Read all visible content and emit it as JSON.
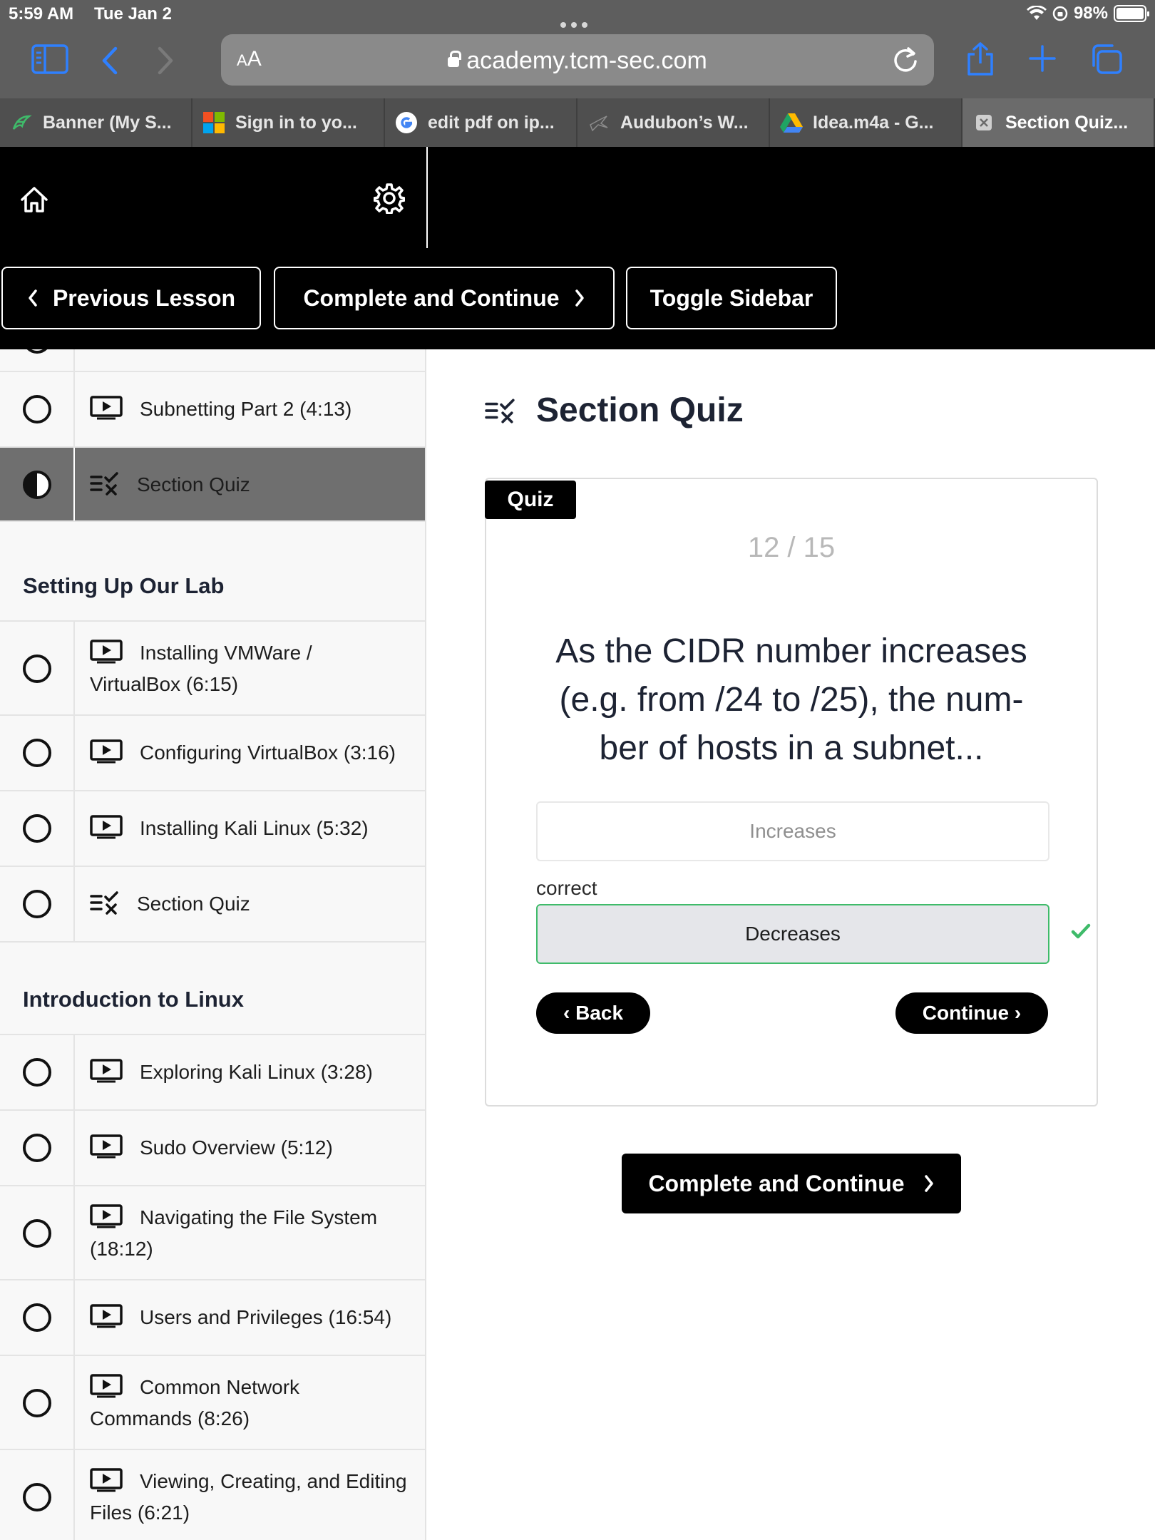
{
  "status_bar": {
    "time": "5:59 AM",
    "date": "Tue Jan 2",
    "battery": "98%"
  },
  "browser": {
    "text_size_label_small": "A",
    "text_size_label_large": "A",
    "url": "academy.tcm-sec.com",
    "tabs": [
      {
        "label": "Banner (My S...",
        "icon": "banner-favicon-icon"
      },
      {
        "label": "Sign in to yo...",
        "icon": "microsoft-favicon-icon"
      },
      {
        "label": "edit pdf on ip...",
        "icon": "google-favicon-icon"
      },
      {
        "label": "Audubon’s W...",
        "icon": "audubon-favicon-icon"
      },
      {
        "label": "Idea.m4a - G...",
        "icon": "google-drive-favicon-icon"
      },
      {
        "label": "Section Quiz...",
        "icon": "close-tab-icon"
      }
    ]
  },
  "course_header": {
    "previous_label": "Previous Lesson",
    "complete_label": "Complete and Continue",
    "toggle_label": "Toggle Sidebar"
  },
  "sidebar": {
    "lessons_top": [
      {
        "label": "Subnetting Part 2 (4:13)",
        "type": "video"
      },
      {
        "label": "Section Quiz",
        "type": "quiz",
        "active": true
      }
    ],
    "sections": [
      {
        "title": "Setting Up Our Lab",
        "lessons": [
          {
            "label_line1": "Installing VMWare /",
            "label_line2": "VirtualBox (6:15)",
            "type": "video"
          },
          {
            "label": "Configuring VirtualBox (3:16)",
            "type": "video"
          },
          {
            "label": "Installing Kali Linux (5:32)",
            "type": "video"
          },
          {
            "label": "Section Quiz",
            "type": "quiz"
          }
        ]
      },
      {
        "title": "Introduction to Linux",
        "lessons": [
          {
            "label": "Exploring Kali Linux (3:28)",
            "type": "video"
          },
          {
            "label": "Sudo Overview (5:12)",
            "type": "video"
          },
          {
            "label_line1": "Navigating the File System",
            "label_line2": "(18:12)",
            "type": "video"
          },
          {
            "label": "Users and Privileges (16:54)",
            "type": "video"
          },
          {
            "label_line1": "Common Network",
            "label_line2": "Commands (8:26)",
            "type": "video"
          },
          {
            "label_line1": "Viewing, Creating, and Editing",
            "label_line2": "Files (6:21)",
            "type": "video"
          }
        ]
      }
    ]
  },
  "main": {
    "heading": "Section Quiz",
    "quiz": {
      "badge": "Quiz",
      "progress": "12 / 15",
      "question_line1": "As the CIDR number increases",
      "question_line2": "(e.g. from /24 to /25), the num-",
      "question_line3": "ber of hosts in a subnet...",
      "options": [
        "Increases",
        "Decreases"
      ],
      "correct_label": "correct",
      "back_label": "‹ Back",
      "continue_label": "Continue ›"
    },
    "complete_label": "Complete and Continue"
  },
  "colors": {
    "chrome_gray": "#5e5e5e",
    "safari_blue": "#2f80ff",
    "header_black": "#000000",
    "active_lesson": "#6f6f6f",
    "correct_green": "#3fbb6a"
  }
}
